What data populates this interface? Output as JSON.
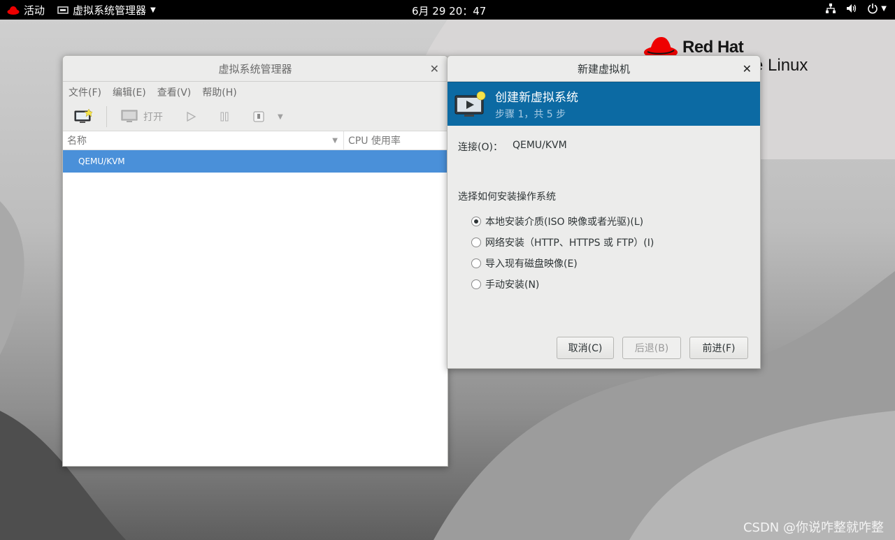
{
  "topbar": {
    "activities": "活动",
    "app_name": "虚拟系统管理器",
    "clock": "6月 29  20：47"
  },
  "desktop": {
    "brand_name": "Red Hat",
    "brand_sub": "e Linux",
    "watermark": "CSDN @你说咋整就咋整"
  },
  "main_window": {
    "title": "虚拟系统管理器",
    "menu": [
      "文件(F)",
      "编辑(E)",
      "查看(V)",
      "帮助(H)"
    ],
    "toolbar": {
      "open_label": "打开"
    },
    "columns": {
      "name": "名称",
      "cpu": "CPU 使用率"
    },
    "rows": [
      "QEMU/KVM"
    ]
  },
  "dialog": {
    "title": "新建虚拟机",
    "banner_title": "创建新虚拟系统",
    "banner_step": "步骤 1，共 5 步",
    "connection_label": "连接(O)：",
    "connection_value": "QEMU/KVM",
    "prompt": "选择如何安装操作系统",
    "options": [
      {
        "label": "本地安装介质(ISO 映像或者光驱)(L)",
        "selected": true
      },
      {
        "label": "网络安装（HTTP、HTTPS 或 FTP）(I)",
        "selected": false
      },
      {
        "label": "导入现有磁盘映像(E)",
        "selected": false
      },
      {
        "label": "手动安装(N)",
        "selected": false
      }
    ],
    "buttons": {
      "cancel": "取消(C)",
      "back": "后退(B)",
      "forward": "前进(F)"
    }
  },
  "colors": {
    "banner": "#0c6aa3",
    "selection": "#4a90d9",
    "redhat": "#ee0000"
  }
}
